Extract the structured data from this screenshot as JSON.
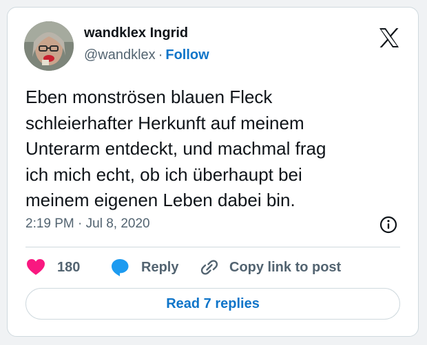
{
  "tweet": {
    "author_name": "wandklex Ingrid",
    "handle": "@wandklex",
    "separator": "·",
    "follow_label": "Follow",
    "text_lines": [
      "Eben monströsen blauen Fleck",
      "schleierhafter Herkunft auf meinem",
      "Unterarm entdeckt, und machmal frag",
      "ich mich echt, ob ich überhaupt bei",
      "meinem eigenen Leben dabei bin."
    ],
    "timestamp": "2:19 PM · Jul 8, 2020"
  },
  "actions": {
    "like_count": "180",
    "reply_label": "Reply",
    "copy_label": "Copy link to post"
  },
  "read_replies_label": "Read 7 replies",
  "icons": {
    "brand": "x-logo-icon",
    "info": "info-icon",
    "like": "heart-icon",
    "reply": "speech-bubble-icon",
    "copy": "link-icon"
  },
  "colors": {
    "link_blue": "#0f75c9",
    "heart_pink": "#f91880",
    "reply_blue": "#1d9bf0",
    "secondary_text": "#536471",
    "border": "#cfd9de"
  }
}
